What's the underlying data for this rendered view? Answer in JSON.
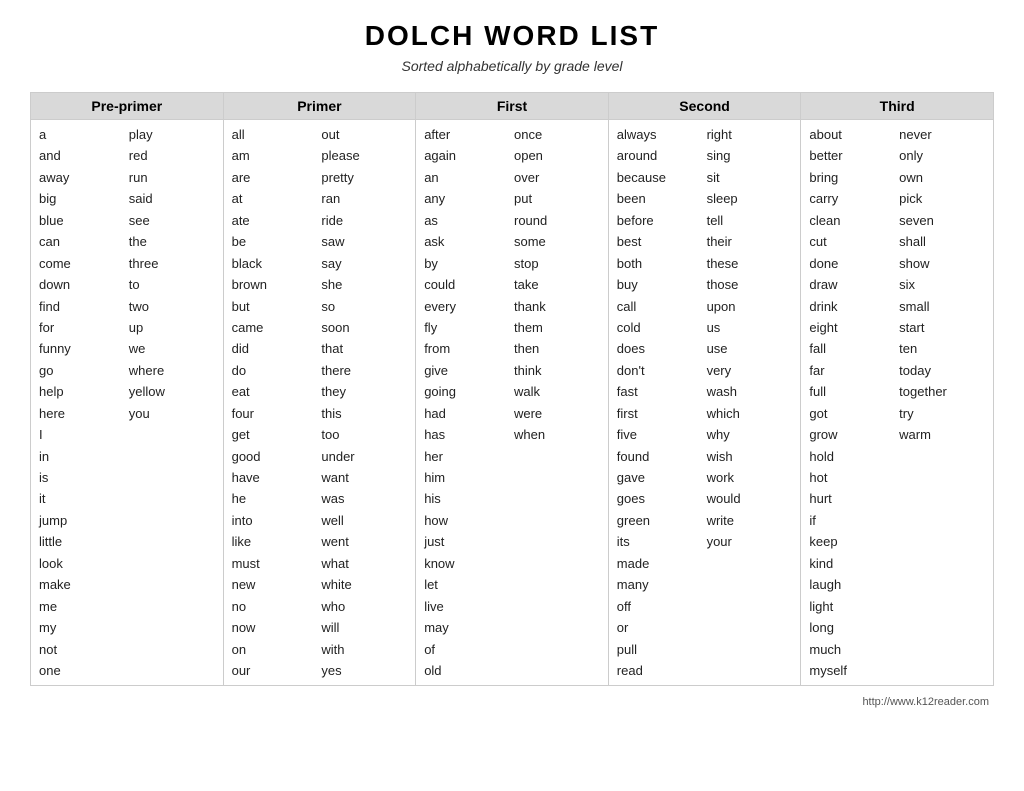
{
  "title": "DOLCH WORD LIST",
  "subtitle": "Sorted alphabetically by grade level",
  "grades": [
    {
      "name": "Pre-primer",
      "columns": [
        [
          "a",
          "and",
          "away",
          "big",
          "blue",
          "can",
          "come",
          "down",
          "find",
          "for",
          "funny",
          "go",
          "help",
          "here",
          "I",
          "in",
          "is",
          "it",
          "jump",
          "little",
          "look",
          "make",
          "me",
          "my",
          "not",
          "one"
        ],
        [
          "play",
          "red",
          "run",
          "said",
          "see",
          "the",
          "three",
          "to",
          "two",
          "up",
          "we",
          "where",
          "yellow",
          "you"
        ]
      ]
    },
    {
      "name": "Primer",
      "columns": [
        [
          "all",
          "am",
          "are",
          "at",
          "ate",
          "be",
          "black",
          "brown",
          "but",
          "came",
          "did",
          "do",
          "eat",
          "four",
          "get",
          "good",
          "have",
          "he",
          "into",
          "like",
          "must",
          "new",
          "no",
          "now",
          "on",
          "our"
        ],
        [
          "out",
          "please",
          "pretty",
          "ran",
          "ride",
          "saw",
          "say",
          "she",
          "so",
          "soon",
          "that",
          "there",
          "they",
          "this",
          "too",
          "under",
          "want",
          "was",
          "well",
          "went",
          "what",
          "white",
          "who",
          "will",
          "with",
          "yes"
        ]
      ]
    },
    {
      "name": "First",
      "columns": [
        [
          "after",
          "again",
          "an",
          "any",
          "as",
          "ask",
          "by",
          "could",
          "every",
          "fly",
          "from",
          "give",
          "going",
          "had",
          "has",
          "her",
          "him",
          "his",
          "how",
          "just",
          "know",
          "let",
          "live",
          "may",
          "of",
          "old"
        ],
        [
          "once",
          "open",
          "over",
          "put",
          "round",
          "some",
          "stop",
          "take",
          "thank",
          "them",
          "then",
          "think",
          "walk",
          "were",
          "when"
        ]
      ]
    },
    {
      "name": "Second",
      "columns": [
        [
          "always",
          "around",
          "because",
          "been",
          "before",
          "best",
          "both",
          "buy",
          "call",
          "cold",
          "does",
          "don't",
          "fast",
          "first",
          "five",
          "found",
          "gave",
          "goes",
          "green",
          "its",
          "made",
          "many",
          "off",
          "or",
          "pull",
          "read"
        ],
        [
          "right",
          "sing",
          "sit",
          "sleep",
          "tell",
          "their",
          "these",
          "those",
          "upon",
          "us",
          "use",
          "very",
          "wash",
          "which",
          "why",
          "wish",
          "work",
          "would",
          "write",
          "your"
        ]
      ]
    },
    {
      "name": "Third",
      "columns": [
        [
          "about",
          "better",
          "bring",
          "carry",
          "clean",
          "cut",
          "done",
          "draw",
          "drink",
          "eight",
          "fall",
          "far",
          "full",
          "got",
          "grow",
          "hold",
          "hot",
          "hurt",
          "if",
          "keep",
          "kind",
          "laugh",
          "light",
          "long",
          "much",
          "myself"
        ],
        [
          "never",
          "only",
          "own",
          "pick",
          "seven",
          "shall",
          "show",
          "six",
          "small",
          "start",
          "ten",
          "today",
          "together",
          "try",
          "warm"
        ]
      ]
    }
  ],
  "footer_url": "http://www.k12reader.com"
}
